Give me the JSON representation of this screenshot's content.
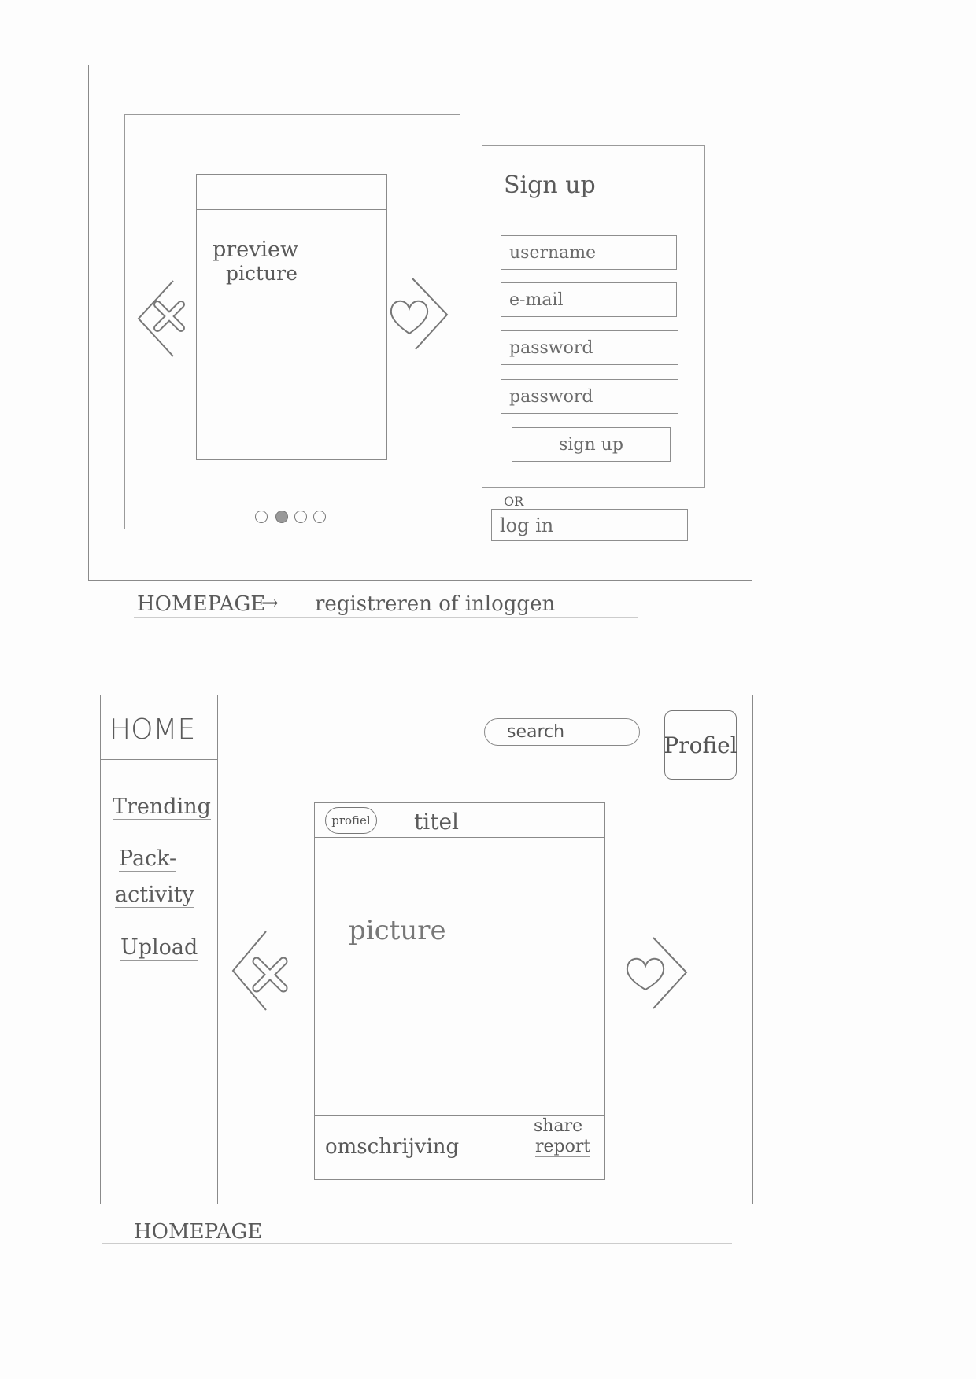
{
  "signup_page": {
    "preview_text": [
      "preview",
      "picture"
    ],
    "carousel_dots": 4,
    "carousel_active_index": 1,
    "signup_title": "Sign up",
    "fields": [
      {
        "placeholder": "username"
      },
      {
        "placeholder": "e-mail"
      },
      {
        "placeholder": "password"
      },
      {
        "placeholder": "password"
      }
    ],
    "signup_button": "sign up",
    "or_label": "OR",
    "login_button": "log in",
    "caption_left": "HOMEPAGE",
    "caption_arrow": "→",
    "caption_right": "registreren of inloggen"
  },
  "home_page": {
    "home_label": "HOME",
    "nav_items": [
      {
        "label": "Trending"
      },
      {
        "label": "Pack-"
      },
      {
        "label": "activity"
      },
      {
        "label": "Upload"
      }
    ],
    "search_placeholder": "search",
    "profile_button": "Profiel",
    "card": {
      "profile_badge": "profiel",
      "title": "titel",
      "picture_label": "picture",
      "description": "omschrijving",
      "share": "share",
      "report": "report"
    },
    "caption": "HOMEPAGE"
  }
}
